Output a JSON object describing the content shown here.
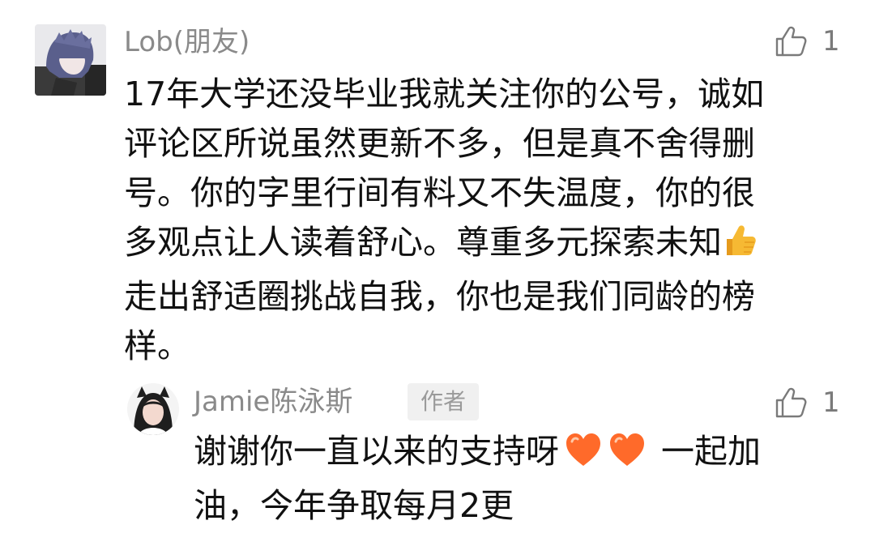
{
  "comment": {
    "author": "Lob(朋友)",
    "likes": "1",
    "avatar_icon": "avatar-icon",
    "lines": [
      "17年大学还没毕业我就关注你的公号，诚如",
      "评论区所说虽然更新不多，但是真不舍得删",
      "号。你的字里行间有料又不失温度，你的很",
      "多观点让人读着舒心。尊重多元探索未知",
      "走出舒适圈挑战自我，你也是我们同龄的榜",
      "样。"
    ],
    "emoji": "thumbs-up-icon"
  },
  "reply": {
    "author": "Jamie陈泳斯",
    "badge": "作者",
    "likes": "1",
    "avatar_icon": "avatar-icon",
    "line1_text": "谢谢你一直以来的支持呀",
    "emojis": [
      "orange-heart-icon",
      "orange-heart-icon"
    ],
    "line1_tail": "一起加",
    "line2": "油，今年争取每月2更"
  },
  "colors": {
    "name_gray": "#8a8a8a",
    "body_text": "#111111",
    "badge_bg": "#f0f0f0",
    "badge_text": "#9a9a9a",
    "thumbs_up": "#f6b933",
    "heart": "#ff6a2a"
  }
}
